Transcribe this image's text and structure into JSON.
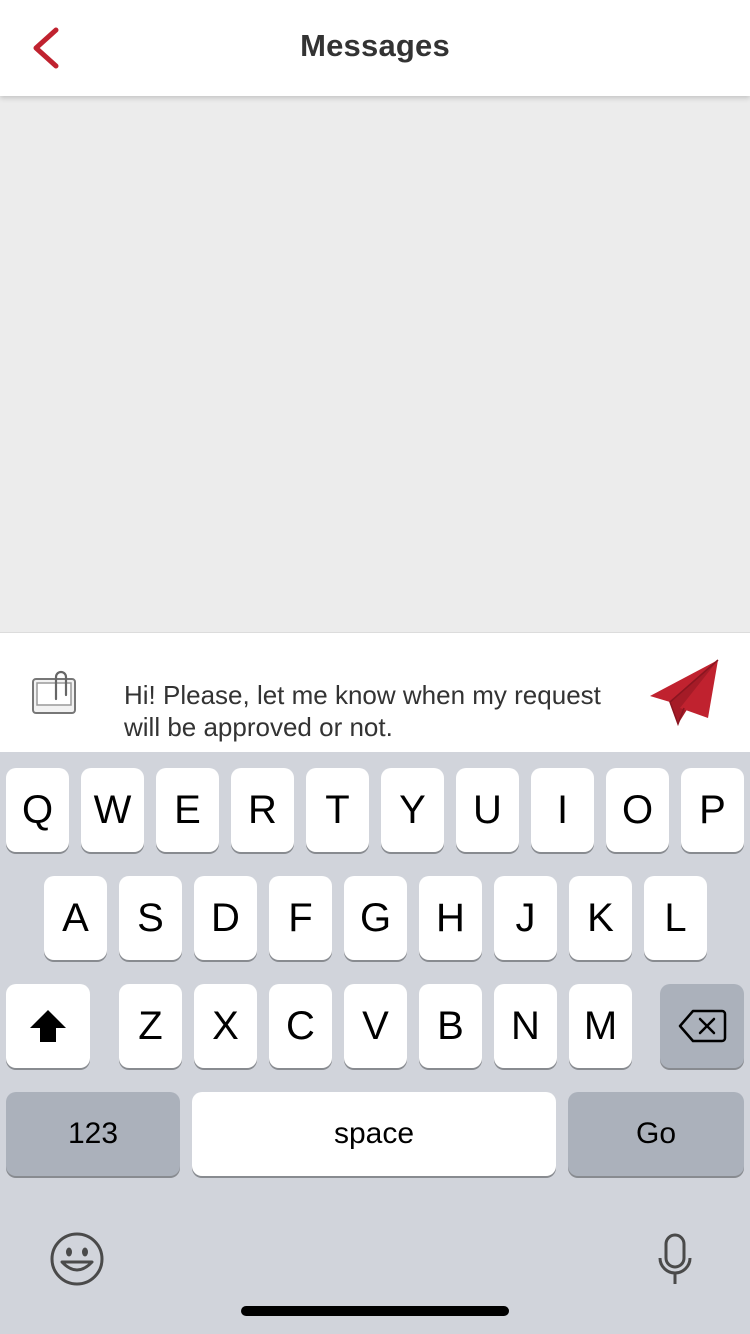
{
  "colors": {
    "accent": "#c0222f",
    "header_bg": "#ffffff",
    "chat_bg": "#ececec",
    "keyboard_bg": "#d1d4db"
  },
  "header": {
    "title": "Messages",
    "back_icon": "chevron-left-icon"
  },
  "composer": {
    "attach_icon": "attachment-clip-icon",
    "message_text": "Hi! Please, let me know when my request will be approved or not.",
    "send_icon": "paper-plane-send-icon"
  },
  "keyboard": {
    "row1": [
      "Q",
      "W",
      "E",
      "R",
      "T",
      "Y",
      "U",
      "I",
      "O",
      "P"
    ],
    "row2": [
      "A",
      "S",
      "D",
      "F",
      "G",
      "H",
      "J",
      "K",
      "L"
    ],
    "row3": [
      "Z",
      "X",
      "C",
      "V",
      "B",
      "N",
      "M"
    ],
    "shift_icon": "shift-arrow-icon",
    "delete_icon": "backspace-icon",
    "numbers_label": "123",
    "space_label": "space",
    "go_label": "Go",
    "emoji_icon": "emoji-icon",
    "mic_icon": "microphone-icon"
  }
}
